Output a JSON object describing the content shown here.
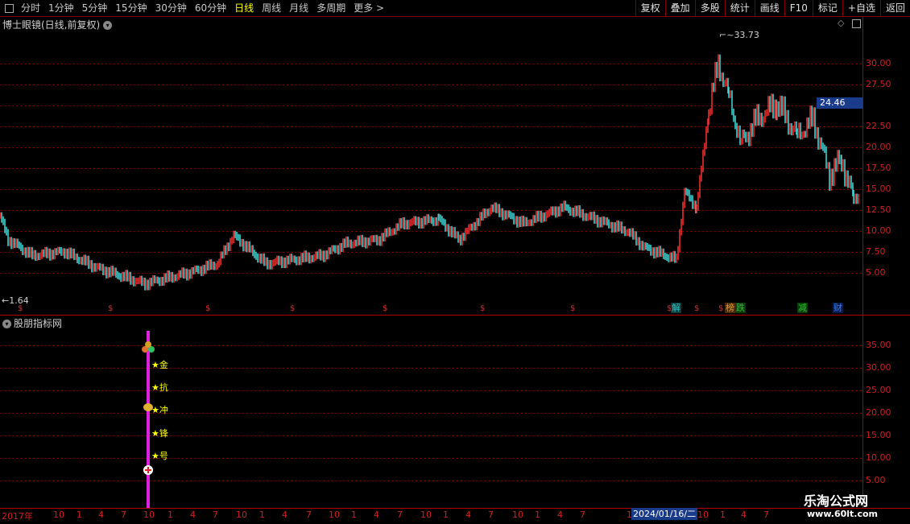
{
  "toolbar": {
    "periods": [
      "分时",
      "1分钟",
      "5分钟",
      "15分钟",
      "30分钟",
      "60分钟",
      "日线",
      "周线",
      "月线",
      "多周期",
      "更多 >"
    ],
    "active_period": "日线",
    "right_buttons": [
      "复权",
      "叠加",
      "多股",
      "统计",
      "画线",
      "F10",
      "标记",
      "+自选",
      "返回"
    ]
  },
  "main_panel": {
    "title": "博士眼镜(日线,前复权)",
    "max_label": "33.73",
    "min_label": "1.64",
    "current_price": "24.46",
    "price_ticks": [
      "30.00",
      "27.50",
      "25.00",
      "22.50",
      "20.00",
      "17.50",
      "15.00",
      "12.50",
      "10.00",
      "7.50",
      "5.00"
    ]
  },
  "indicator_panel": {
    "title": "股朋指标网",
    "ticks": [
      "35.00",
      "30.00",
      "25.00",
      "20.00",
      "15.00",
      "10.00",
      "5.00"
    ],
    "labels": [
      "★金",
      "★抗",
      "★冲",
      "★锋",
      "★号"
    ]
  },
  "events": {
    "markers": [
      "$",
      "$",
      "$",
      "$",
      "$",
      "$",
      "$",
      "$",
      "$",
      "$"
    ],
    "tags": [
      {
        "text": "解",
        "color": "#30c0c0"
      },
      {
        "text": "榜",
        "color": "#e0a030"
      },
      {
        "text": "跌",
        "color": "#30c030"
      },
      {
        "text": "减",
        "color": "#30c030"
      },
      {
        "text": "财",
        "color": "#3080ff"
      }
    ]
  },
  "x_axis": {
    "ticks": [
      "2017年",
      "10",
      "1",
      "4",
      "7",
      "10",
      "1",
      "4",
      "7",
      "10",
      "1",
      "4",
      "7",
      "10",
      "1",
      "4",
      "7",
      "10",
      "1",
      "4",
      "7",
      "10",
      "1",
      "4",
      "7",
      "1",
      "10",
      "1",
      "4",
      "7"
    ],
    "cursor_date": "2024/01/16/二"
  },
  "watermark": {
    "name": "乐淘公式网",
    "url": "www.60lt.com"
  }
}
